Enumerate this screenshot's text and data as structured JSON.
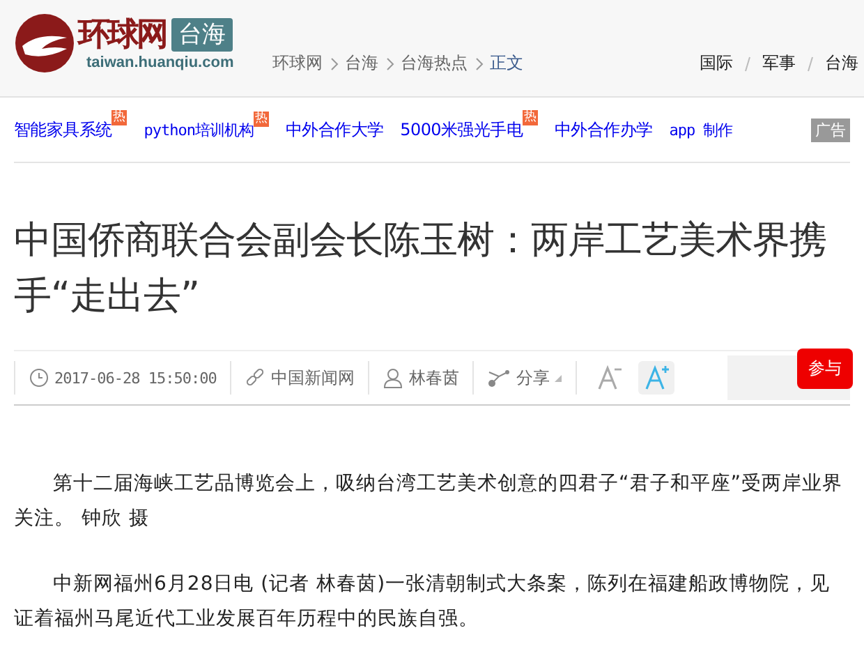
{
  "header": {
    "logo_text": "环球网",
    "logo_channel": "台海",
    "logo_domain": "taiwan.huanqiu.com",
    "breadcrumb": [
      {
        "label": "环球网",
        "current": false
      },
      {
        "label": "台海",
        "current": false
      },
      {
        "label": "台海热点",
        "current": false
      },
      {
        "label": "正文",
        "current": true
      }
    ],
    "nav": [
      "国际",
      "军事",
      "台海"
    ]
  },
  "promo_links": [
    {
      "label": "智能家具系统",
      "badge": "热"
    },
    {
      "label": "python培训机构",
      "badge": "热"
    },
    {
      "label": "中外合作大学"
    },
    {
      "label": "5000米强光手电",
      "badge": "热"
    },
    {
      "label": "中外合作办学"
    },
    {
      "label": "app 制作"
    }
  ],
  "ad_label": "广告",
  "article": {
    "title": "中国侨商联合会副会长陈玉树：两岸工艺美术界携手“走出去”",
    "meta": {
      "time": "2017-06-28 15:50:00",
      "source": "中国新闻网",
      "author": "林春茵",
      "share": "分享"
    },
    "font_buttons": [
      {
        "kind": "decrease",
        "highlighted": false
      },
      {
        "kind": "increase",
        "highlighted": true
      }
    ],
    "join_button": "参与",
    "paragraphs": [
      "第十二届海峡工艺品博览会上，吸纳台湾工艺美术创意的四君子“君子和平座”受两岸业界关注。 钟欣 摄",
      "中新网福州6月28日电 (记者 林春茵)一张清朝制式大条案，陈列在福建船政博物院，见证着福州马尾近代工业发展百年历程中的民族自强。"
    ]
  }
}
